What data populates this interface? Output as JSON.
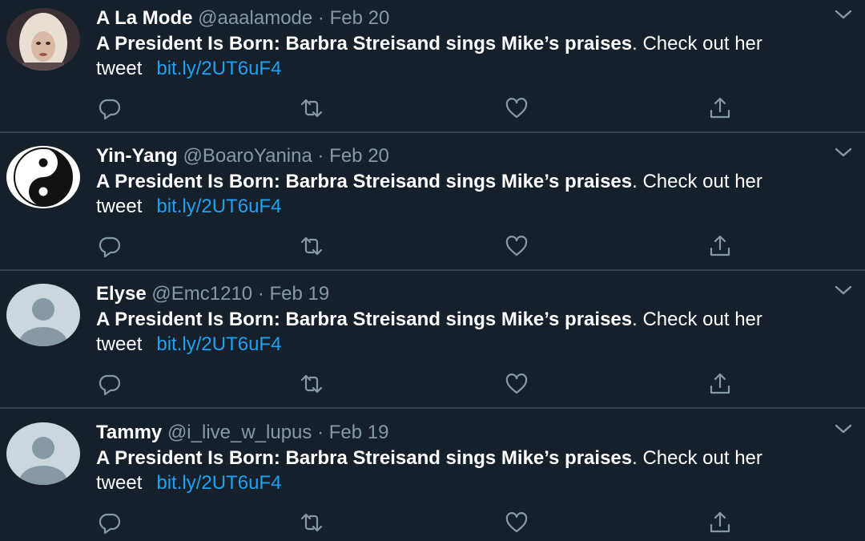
{
  "tweets": [
    {
      "name": "A La Mode",
      "handle": "@aaalamode",
      "separator": "·",
      "date": "Feb 20",
      "text_bold": "A President Is Born: Barbra Streisand sings Mike’s praises",
      "text_rest": ". Check out her tweet",
      "link": "bit.ly/2UT6uF4",
      "avatar": "portrait-photo"
    },
    {
      "name": "Yin-Yang",
      "handle": "@BoaroYanina",
      "separator": "·",
      "date": "Feb 20",
      "text_bold": "A President Is Born: Barbra Streisand sings Mike’s praises",
      "text_rest": ". Check out her tweet",
      "link": "bit.ly/2UT6uF4",
      "avatar": "yin-yang-icon"
    },
    {
      "name": "Elyse",
      "handle": "@Emc1210",
      "separator": "·",
      "date": "Feb 19",
      "text_bold": "A President Is Born: Barbra Streisand sings Mike’s praises",
      "text_rest": ". Check out her tweet",
      "link": "bit.ly/2UT6uF4",
      "avatar": "default-avatar-icon"
    },
    {
      "name": "Tammy",
      "handle": "@i_live_w_lupus",
      "separator": "·",
      "date": "Feb 19",
      "text_bold": "A President Is Born: Barbra Streisand sings Mike’s praises",
      "text_rest": ". Check out her tweet",
      "link": "bit.ly/2UT6uF4",
      "avatar": "default-avatar-icon"
    }
  ],
  "icons": {
    "reply": "reply-icon",
    "retweet": "retweet-icon",
    "like": "heart-icon",
    "share": "share-icon",
    "menu": "chevron-down-icon"
  },
  "colors": {
    "background": "#15202b",
    "divider": "#38444d",
    "text": "#ffffff",
    "muted": "#8899a6",
    "link": "#1da1f2"
  }
}
